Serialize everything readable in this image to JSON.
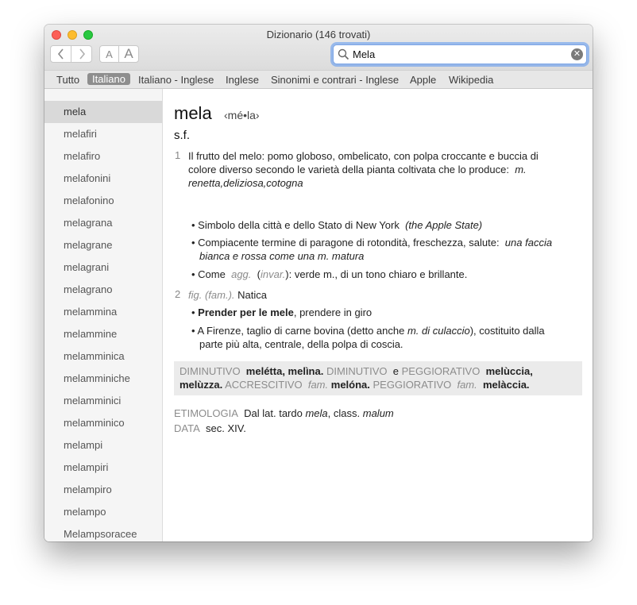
{
  "window": {
    "title": "Dizionario (146 trovati)"
  },
  "toolbar": {
    "back_label": "‹",
    "forward_label": "›",
    "font_small_label": "A",
    "font_large_label": "A"
  },
  "search": {
    "value": "Mela",
    "placeholder": ""
  },
  "tabs": [
    {
      "label": "Tutto"
    },
    {
      "label": "Italiano"
    },
    {
      "label": "Italiano - Inglese"
    },
    {
      "label": "Inglese"
    },
    {
      "label": "Sinonimi e contrari - Inglese"
    },
    {
      "label": "Apple"
    },
    {
      "label": "Wikipedia"
    }
  ],
  "sidebar": {
    "items": [
      {
        "label": "mela"
      },
      {
        "label": "melafiri"
      },
      {
        "label": "melafiro"
      },
      {
        "label": "melafonini"
      },
      {
        "label": "melafonino"
      },
      {
        "label": "melagrana"
      },
      {
        "label": "melagrane"
      },
      {
        "label": "melagrani"
      },
      {
        "label": "melagrano"
      },
      {
        "label": "melammina"
      },
      {
        "label": "melammine"
      },
      {
        "label": "melamminica"
      },
      {
        "label": "melamminiche"
      },
      {
        "label": "melamminici"
      },
      {
        "label": "melamminico"
      },
      {
        "label": "melampi"
      },
      {
        "label": "melampiri"
      },
      {
        "label": "melampiro"
      },
      {
        "label": "melampo"
      },
      {
        "label": "Melampsoracee"
      }
    ]
  },
  "entry": {
    "headword": "mela",
    "pronunciation": "‹mé•la›",
    "part_of_speech": "s.f.",
    "sense1": {
      "num": "1",
      "def_line1": "Il frutto del melo: pomo globoso, ombelicato, con polpa croccante e buccia di",
      "def_line2": "colore diverso secondo le varietà della pianta coltivata che lo produce:",
      "def_line2_ital": "m.",
      "def_line3_ital": "renetta,deliziosa,cotogna",
      "b1_text": "Simbolo della città e dello Stato di New York",
      "b1_ital": "(the Apple State)",
      "b2_text": "Compiacente termine di paragone di rotondità, freschezza, salute:",
      "b2_ital1": "una faccia",
      "b2_ital2": "bianca e rossa come una m. matura",
      "b3_text1": "Come",
      "b3_gray1": "agg.",
      "b3_paren_open": "(",
      "b3_gray2": "invar.",
      "b3_text2": "): verde m., di un tono chiaro e brillante."
    },
    "sense2": {
      "num": "2",
      "label": "fig. (fam.).",
      "def": "Natica",
      "b1_bold": "Prender per le mele",
      "b1_text": ", prendere in giro",
      "b2_text1": "A Firenze, taglio di carne bovina (detto anche",
      "b2_ital": "m. di culaccio",
      "b2_text2": "), costituito dalla",
      "b2_line2": "parte più alta, centrale, della polpa di coscia."
    },
    "derivatives": {
      "l1_label1": "DIMINUTIVO",
      "l1_word1": "melétta, melìna.",
      "l1_label2": "DIMINUTIVO",
      "l1_conj": "e",
      "l1_label3": "PEGGIORATIVO",
      "l1_word2": "melùccia,",
      "l2_word1": "melùzza.",
      "l2_label1": "ACCRESCITIVO",
      "l2_fam1": "fam.",
      "l2_word2": "melóna.",
      "l2_label2": "PEGGIORATIVO",
      "l2_fam2": "fam.",
      "l2_word3": "melàccia."
    },
    "etymology": {
      "label": "ETIMOLOGIA",
      "text1": "Dal lat. tardo",
      "ital1": "mela",
      "text2": ", class.",
      "ital2": "malum"
    },
    "date": {
      "label": "DATA",
      "value": "sec. XIV."
    }
  }
}
